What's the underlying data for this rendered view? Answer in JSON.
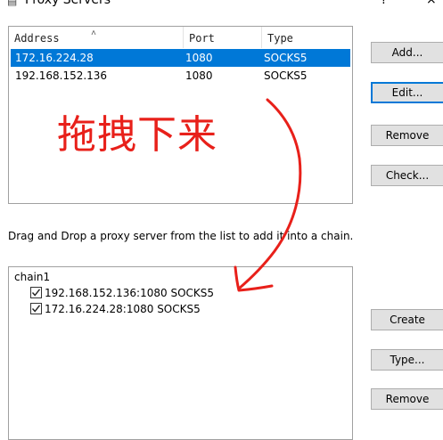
{
  "window": {
    "title": "Proxy Servers",
    "app_icon": "proxy-app-icon",
    "help_glyph": "?",
    "close_glyph": "×"
  },
  "server_list": {
    "columns": [
      "Address",
      "Port",
      "Type"
    ],
    "sort_indicator": "˄",
    "rows": [
      {
        "address": "172.16.224.28",
        "port": "1080",
        "type": "SOCKS5",
        "selected": true
      },
      {
        "address": "192.168.152.136",
        "port": "1080",
        "type": "SOCKS5",
        "selected": false
      }
    ]
  },
  "server_buttons": {
    "add": "Add...",
    "edit": "Edit...",
    "remove": "Remove",
    "check": "Check..."
  },
  "instruction": "Drag and Drop a proxy server from the list to add it into a chain.",
  "annotation": {
    "text": "拖拽下来",
    "color": "#e8201a"
  },
  "chain_tree": {
    "root": "chain1",
    "items": [
      {
        "label": "192.168.152.136:1080 SOCKS5",
        "checked": true
      },
      {
        "label": "172.16.224.28:1080 SOCKS5",
        "checked": true
      }
    ]
  },
  "chain_buttons": {
    "create": "Create",
    "type": "Type...",
    "remove": "Remove"
  },
  "colors": {
    "selection": "#0078d7",
    "button_face": "#e1e1e1",
    "focus_border": "#0078d7"
  }
}
